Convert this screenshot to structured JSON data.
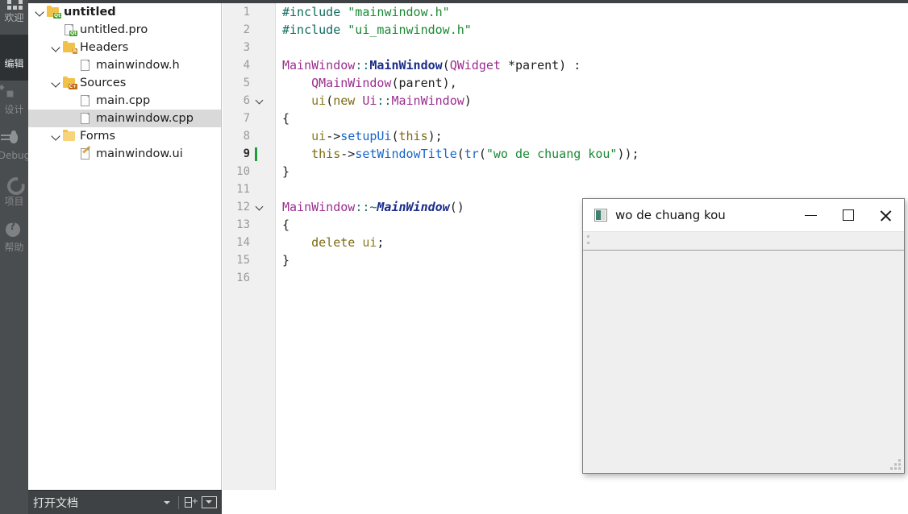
{
  "mode_bar": {
    "items": [
      {
        "label": "欢迎",
        "icon": "welcome-grid-icon",
        "active": false
      },
      {
        "label": "编辑",
        "icon": "edit-document-icon",
        "active": true
      },
      {
        "label": "设计",
        "icon": "design-diamond-icon",
        "active": false
      },
      {
        "label": "Debug",
        "icon": "bug-icon",
        "active": false
      },
      {
        "label": "项目",
        "icon": "wrench-icon",
        "active": false
      },
      {
        "label": "帮助",
        "icon": "help-question-icon",
        "active": false
      }
    ]
  },
  "project_tree": {
    "items": [
      {
        "label": "untitled",
        "icon": "qt-project-folder-icon",
        "indent": 0,
        "expanded": true,
        "selected": false,
        "bold": true
      },
      {
        "label": "untitled.pro",
        "icon": "qt-pro-file-icon",
        "indent": 1,
        "expanded": null,
        "selected": false,
        "bold": false
      },
      {
        "label": "Headers",
        "icon": "headers-folder-icon",
        "indent": 1,
        "expanded": true,
        "selected": false,
        "bold": false
      },
      {
        "label": "mainwindow.h",
        "icon": "file-icon",
        "indent": 2,
        "expanded": null,
        "selected": false,
        "bold": false
      },
      {
        "label": "Sources",
        "icon": "sources-folder-icon",
        "indent": 1,
        "expanded": true,
        "selected": false,
        "bold": false
      },
      {
        "label": "main.cpp",
        "icon": "file-icon",
        "indent": 2,
        "expanded": null,
        "selected": false,
        "bold": false
      },
      {
        "label": "mainwindow.cpp",
        "icon": "file-icon",
        "indent": 2,
        "expanded": null,
        "selected": true,
        "bold": false
      },
      {
        "label": "Forms",
        "icon": "forms-folder-icon",
        "indent": 1,
        "expanded": true,
        "selected": false,
        "bold": false
      },
      {
        "label": "mainwindow.ui",
        "icon": "ui-form-file-icon",
        "indent": 2,
        "expanded": null,
        "selected": false,
        "bold": false
      }
    ]
  },
  "open_documents_bar": {
    "label": "打开文档",
    "caret_icon": "chevron-down-icon",
    "split_icon": "split-editor-icon",
    "split_plus": "+",
    "close_icon": "close-panel-dropdown-icon"
  },
  "editor": {
    "current_line": 9,
    "lines": [
      {
        "n": "1",
        "fold": false,
        "tokens": [
          {
            "t": "#include ",
            "c": "k-pre"
          },
          {
            "t": "\"mainwindow.h\"",
            "c": "k-str"
          }
        ]
      },
      {
        "n": "2",
        "fold": false,
        "tokens": [
          {
            "t": "#include ",
            "c": "k-pre"
          },
          {
            "t": "\"ui_mainwindow.h\"",
            "c": "k-str"
          }
        ]
      },
      {
        "n": "3",
        "fold": false,
        "tokens": []
      },
      {
        "n": "4",
        "fold": false,
        "tokens": [
          {
            "t": "MainWindow",
            "c": "k-type"
          },
          {
            "t": "::",
            "c": "k-op"
          },
          {
            "t": "MainWindow",
            "c": "k-typeb"
          },
          {
            "t": "(",
            "c": "k-plain"
          },
          {
            "t": "QWidget",
            "c": "k-type"
          },
          {
            "t": " *parent) :",
            "c": "k-plain"
          }
        ]
      },
      {
        "n": "5",
        "fold": false,
        "tokens": [
          {
            "t": "    ",
            "c": "k-plain"
          },
          {
            "t": "QMainWindow",
            "c": "k-type"
          },
          {
            "t": "(parent),",
            "c": "k-plain"
          }
        ]
      },
      {
        "n": "6",
        "fold": true,
        "tokens": [
          {
            "t": "    ",
            "c": "k-plain"
          },
          {
            "t": "ui",
            "c": "k-var"
          },
          {
            "t": "(",
            "c": "k-plain"
          },
          {
            "t": "new ",
            "c": "k-kw"
          },
          {
            "t": "Ui",
            "c": "k-type"
          },
          {
            "t": "::",
            "c": "k-op"
          },
          {
            "t": "MainWindow",
            "c": "k-type"
          },
          {
            "t": ")",
            "c": "k-plain"
          }
        ]
      },
      {
        "n": "7",
        "fold": false,
        "tokens": [
          {
            "t": "{",
            "c": "k-plain"
          }
        ]
      },
      {
        "n": "8",
        "fold": false,
        "tokens": [
          {
            "t": "    ",
            "c": "k-plain"
          },
          {
            "t": "ui",
            "c": "k-var"
          },
          {
            "t": "->",
            "c": "k-plain"
          },
          {
            "t": "setupUi",
            "c": "k-fn"
          },
          {
            "t": "(",
            "c": "k-plain"
          },
          {
            "t": "this",
            "c": "k-kw"
          },
          {
            "t": ");",
            "c": "k-plain"
          }
        ]
      },
      {
        "n": "9",
        "fold": false,
        "tokens": [
          {
            "t": "    ",
            "c": "k-plain"
          },
          {
            "t": "this",
            "c": "k-kw"
          },
          {
            "t": "->",
            "c": "k-plain"
          },
          {
            "t": "setWindowTitle",
            "c": "k-fn"
          },
          {
            "t": "(",
            "c": "k-plain"
          },
          {
            "t": "tr",
            "c": "k-fn"
          },
          {
            "t": "(",
            "c": "k-plain"
          },
          {
            "t": "\"wo de chuang kou\"",
            "c": "k-str"
          },
          {
            "t": "));",
            "c": "k-plain"
          }
        ]
      },
      {
        "n": "10",
        "fold": false,
        "tokens": [
          {
            "t": "}",
            "c": "k-plain"
          }
        ]
      },
      {
        "n": "11",
        "fold": false,
        "tokens": []
      },
      {
        "n": "12",
        "fold": true,
        "tokens": [
          {
            "t": "MainWindow",
            "c": "k-type"
          },
          {
            "t": "::~",
            "c": "k-op"
          },
          {
            "t": "MainWindow",
            "c": "k-typei"
          },
          {
            "t": "()",
            "c": "k-plain"
          }
        ]
      },
      {
        "n": "13",
        "fold": false,
        "tokens": [
          {
            "t": "{",
            "c": "k-plain"
          }
        ]
      },
      {
        "n": "14",
        "fold": false,
        "tokens": [
          {
            "t": "    ",
            "c": "k-plain"
          },
          {
            "t": "delete ",
            "c": "k-kw"
          },
          {
            "t": "ui",
            "c": "k-var"
          },
          {
            "t": ";",
            "c": "k-plain"
          }
        ]
      },
      {
        "n": "15",
        "fold": false,
        "tokens": [
          {
            "t": "}",
            "c": "k-plain"
          }
        ]
      },
      {
        "n": "16",
        "fold": false,
        "tokens": []
      }
    ]
  },
  "app_window": {
    "title": "wo de chuang kou",
    "app_icon": "qt-window-icon",
    "minimize_icon": "minimize-icon",
    "maximize_icon": "maximize-icon",
    "close_icon": "close-icon",
    "toolbar_grip_icon": "toolbar-grip-icon",
    "size_grip_icon": "resize-grip-icon"
  },
  "colors": {
    "mode_bar_bg": "#4a4d4f",
    "mode_bar_active_bg": "#2e3133",
    "gutter_bg": "#f0f0f0",
    "selection_bg": "#d9d9d9",
    "cursor_green": "#1f9d3a",
    "string_green": "#1a8a33",
    "type_purple": "#9b2d8f",
    "function_blue": "#1666c8",
    "preproc_teal": "#0e6b5e"
  }
}
